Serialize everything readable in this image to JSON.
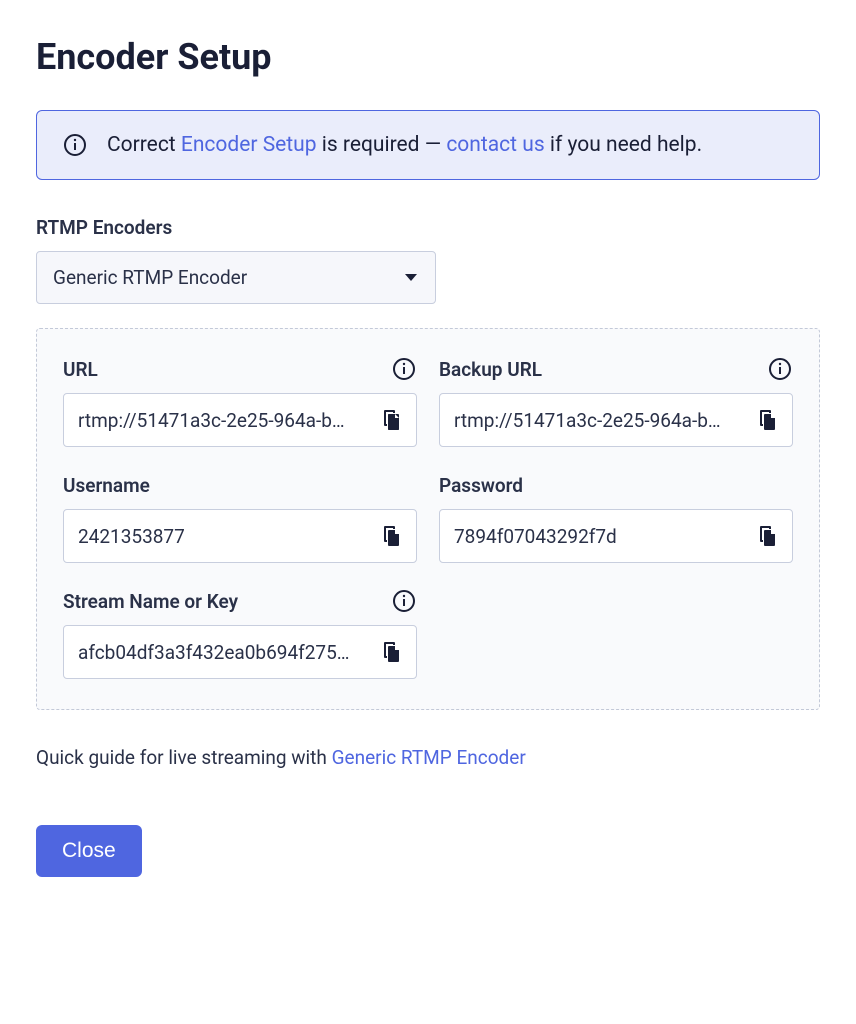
{
  "title": "Encoder Setup",
  "alert": {
    "prefix": "Correct ",
    "link1": "Encoder Setup",
    "middle": " is required — ",
    "link2": "contact us",
    "suffix": " if you need help."
  },
  "encoders": {
    "label": "RTMP Encoders",
    "selected": "Generic RTMP Encoder"
  },
  "fields": {
    "url": {
      "label": "URL",
      "value": "rtmp://51471a3c-2e25-964a-b…"
    },
    "backup_url": {
      "label": "Backup URL",
      "value": "rtmp://51471a3c-2e25-964a-b…"
    },
    "username": {
      "label": "Username",
      "value": "2421353877"
    },
    "password": {
      "label": "Password",
      "value": "7894f07043292f7d"
    },
    "stream_key": {
      "label": "Stream Name or Key",
      "value": "afcb04df3a3f432ea0b694f275…"
    }
  },
  "guide": {
    "prefix": "Quick guide for live streaming with ",
    "link": "Generic RTMP Encoder"
  },
  "buttons": {
    "close": "Close"
  }
}
